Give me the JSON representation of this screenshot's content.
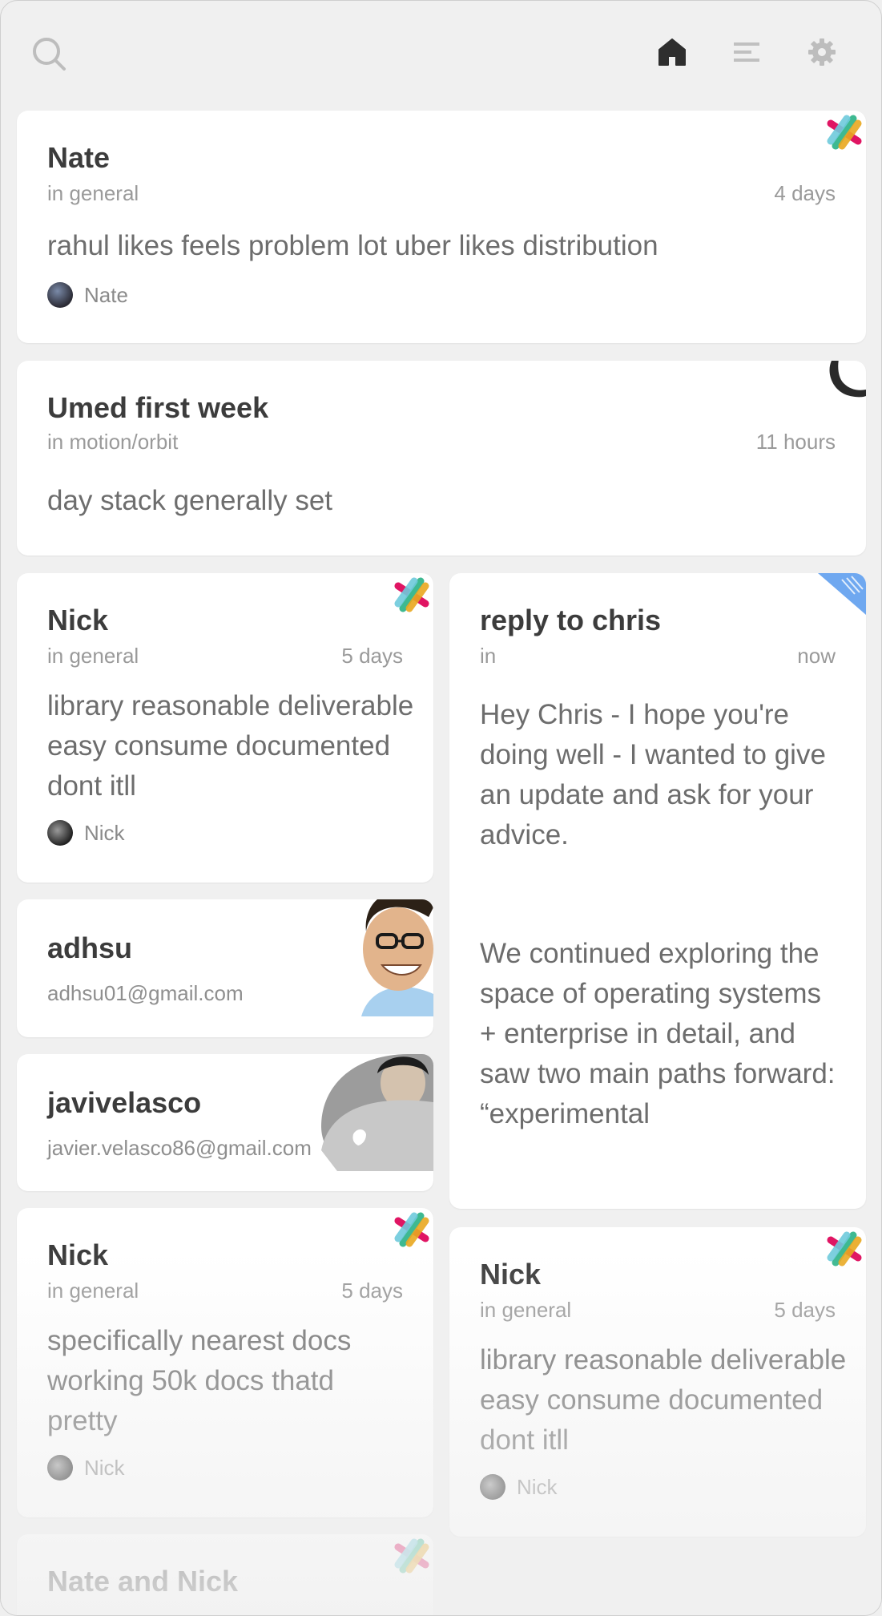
{
  "toolbar": {
    "search_icon": "search-icon",
    "home_icon": "home-icon",
    "menu_icon": "menu-icon",
    "settings_icon": "gear-icon"
  },
  "cards": [
    {
      "title": "Nate",
      "channel": "in general",
      "time": "4 days",
      "body": "rahul likes feels problem lot uber likes distribution",
      "author": "Nate",
      "source_icon": "slack-icon"
    },
    {
      "title": "Umed first week",
      "channel": "in motion/orbit",
      "time": "11 hours",
      "body": "day stack generally set",
      "source_icon": "phone-icon"
    },
    {
      "title": "Nick",
      "channel": "in general",
      "time": "5 days",
      "body": "library reasonable deliverable easy consume documented dont itll",
      "author": "Nick",
      "source_icon": "slack-icon"
    },
    {
      "title": "reply to chris",
      "channel": "in",
      "time": "now",
      "body1": "Hey Chris - I hope you're doing well - I wanted to give an update and ask for your advice.",
      "body2": "We continued exploring the space of operating systems + enterprise in detail, and saw two main paths forward: “experimental",
      "source_icon": "note-icon"
    },
    {
      "title": "adhsu",
      "email": "adhsu01@gmail.com"
    },
    {
      "title": "javivelasco",
      "email": "javier.velasco86@gmail.com"
    },
    {
      "title": "Nick",
      "channel": "in general",
      "time": "5 days",
      "body": "specifically nearest docs working 50k docs thatd pretty",
      "author": "Nick",
      "source_icon": "slack-icon"
    },
    {
      "title": "Nick",
      "channel": "in general",
      "time": "5 days",
      "body": "library reasonable deliverable easy consume documented dont itll",
      "author": "Nick",
      "source_icon": "slack-icon"
    },
    {
      "title": "Nate and Nick",
      "source_icon": "slack-icon"
    }
  ],
  "colors": {
    "slack_green": "#3eb991",
    "slack_blue": "#6ecadc",
    "slack_yellow": "#e9a820",
    "slack_red": "#e01563",
    "note_blue": "#6fa8f0"
  }
}
